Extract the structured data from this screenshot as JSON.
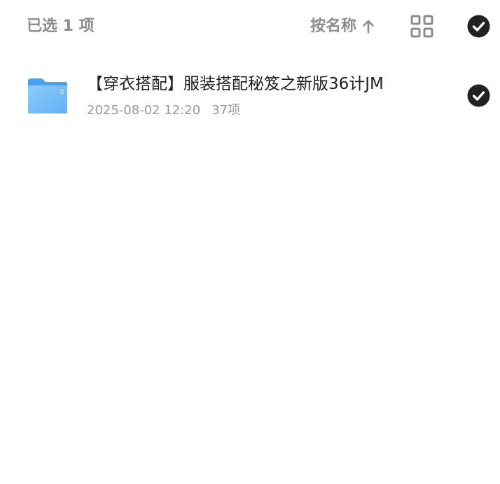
{
  "header": {
    "selected_text": "已选 1 项",
    "sort_label": "按名称",
    "sort_direction_icon": "arrow-up-icon",
    "view_toggle_icon": "grid-view-icon",
    "select_all_icon": "check-circle-icon"
  },
  "files": [
    {
      "name": "【穿衣搭配】服装搭配秘笈之新版36计JM",
      "date": "2025-08-02 12:20",
      "count": "37项",
      "type_icon": "folder-icon",
      "selected": true
    }
  ],
  "colors": {
    "muted_text": "#8c8c8c",
    "primary_text": "#1f1f1f",
    "meta_text": "#999999",
    "check_fill": "#222222",
    "folder_blue": "#6db8f5"
  }
}
